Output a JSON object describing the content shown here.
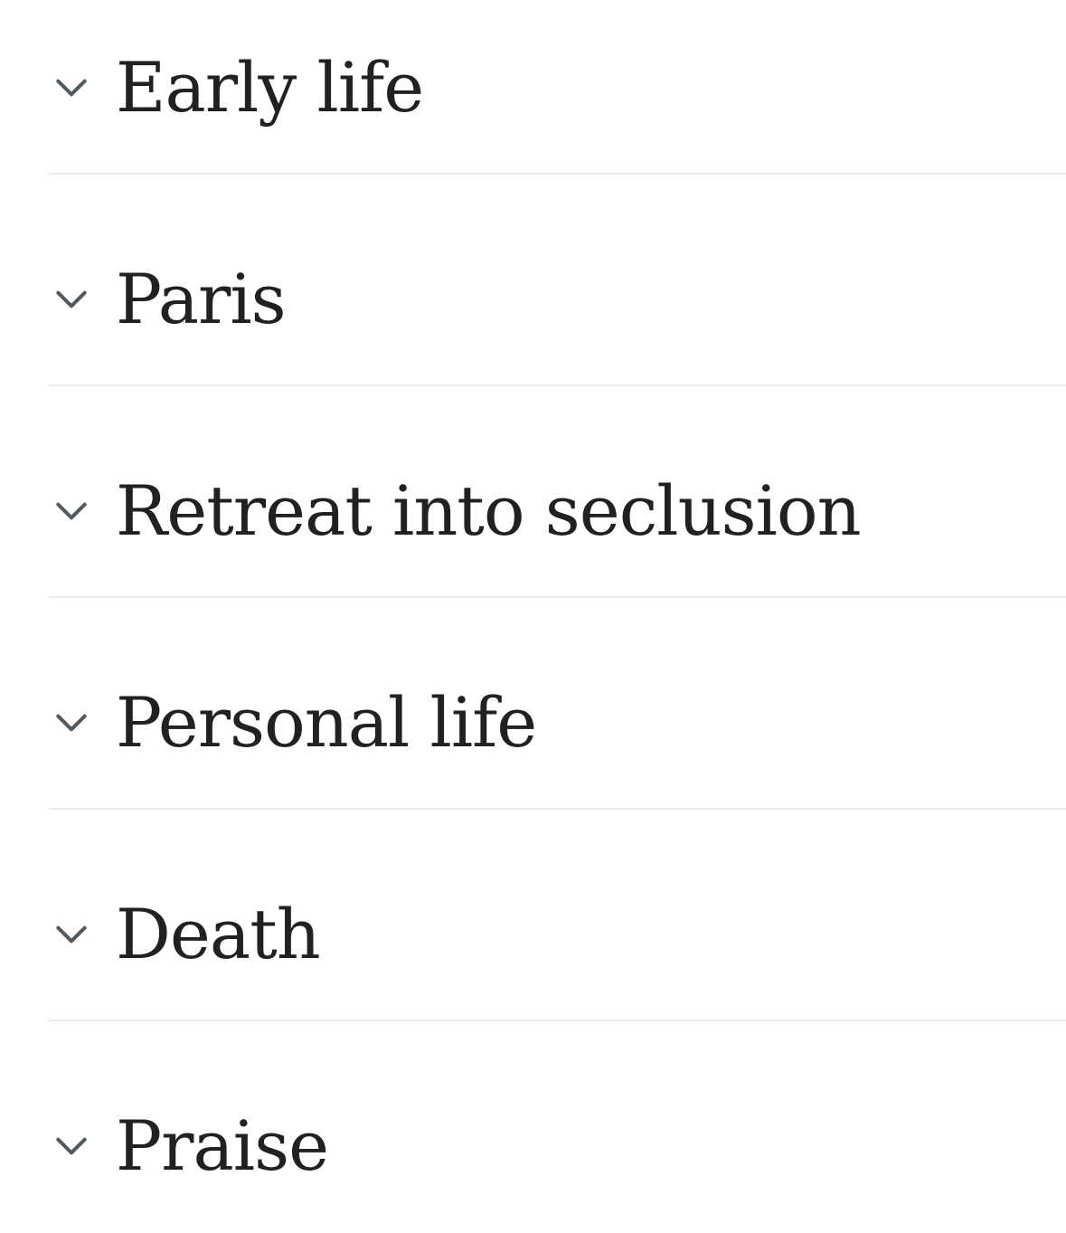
{
  "sections": [
    {
      "label": "Early life",
      "icon": "chevron-down-icon"
    },
    {
      "label": "Paris",
      "icon": "chevron-down-icon"
    },
    {
      "label": "Retreat into seclusion",
      "icon": "chevron-down-icon"
    },
    {
      "label": "Personal life",
      "icon": "chevron-down-icon"
    },
    {
      "label": "Death",
      "icon": "chevron-down-icon"
    },
    {
      "label": "Praise",
      "icon": "chevron-down-icon"
    }
  ],
  "colors": {
    "text": "#202122",
    "chevron": "#54595d",
    "divider": "#eaecf0",
    "background": "#ffffff"
  }
}
